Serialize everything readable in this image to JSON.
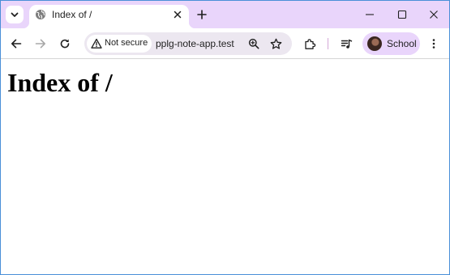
{
  "tab": {
    "title": "Index of /"
  },
  "omnibox": {
    "security_label": "Not secure",
    "url": "pplg-note-app.test"
  },
  "profile": {
    "label": "School"
  },
  "page": {
    "heading": "Index of /"
  },
  "colors": {
    "tabstrip": "#e9d5fb",
    "omnibox": "#ece7f0",
    "window_border": "#4a8fd8"
  },
  "icons": [
    "tab-search-icon",
    "globe-icon",
    "close-icon",
    "plus-icon",
    "minimize-icon",
    "maximize-icon",
    "window-close-icon",
    "back-arrow-icon",
    "forward-arrow-icon",
    "reload-icon",
    "warning-icon",
    "zoom-icon",
    "star-icon",
    "extensions-icon",
    "media-control-icon",
    "menu-icon"
  ]
}
